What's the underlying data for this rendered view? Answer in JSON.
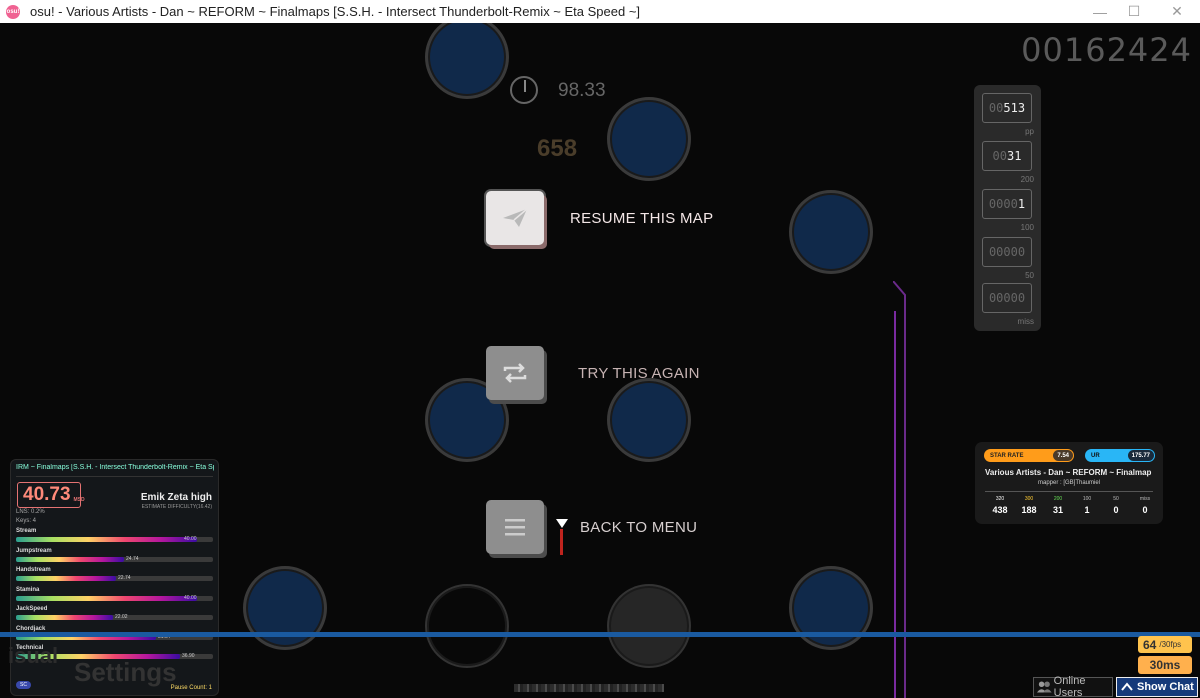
{
  "window": {
    "title": "osu!  - Various Artists - Dan ~ REFORM ~ Finalmaps [S.S.H. - Intersect Thunderbolt-Remix ~ Eta Speed ~]",
    "app_icon_text": "osu!",
    "minimize": "—",
    "maximize": "☐",
    "close": "✕"
  },
  "hud": {
    "score": "00162424",
    "accuracy": "98.33",
    "combo": "658"
  },
  "pause_menu": {
    "resume": "RESUME THIS MAP",
    "retry": "TRY THIS AGAIN",
    "back": "BACK TO MENU"
  },
  "judgement_counter": [
    {
      "lead": "00",
      "value": "513",
      "label": "pp"
    },
    {
      "lead": "00",
      "value": "31",
      "label": "200"
    },
    {
      "lead": "0000",
      "value": "1",
      "label": "100"
    },
    {
      "lead": "00000",
      "value": "",
      "label": "50"
    },
    {
      "lead": "00000",
      "value": "",
      "label": "miss"
    }
  ],
  "difficulty_panel": {
    "map_name": "IRM ~ Finalmaps [S.S.H. - Intersect Thunderbolt-Remix ~ Eta Speed",
    "msd_value": "40.73",
    "msd_unit": "MSD",
    "player_label": "Emik Zeta high",
    "estimate": "ESTIMATE DIFFICULTY(16.42)",
    "lns": "LNS: 0.2%",
    "keys": "Keys: 4",
    "skills": [
      {
        "name": "Stream",
        "value": "40.00",
        "fraction": 0.92
      },
      {
        "name": "Jumpstream",
        "value": "24.74",
        "fraction": 0.55
      },
      {
        "name": "Handstream",
        "value": "22.74",
        "fraction": 0.51
      },
      {
        "name": "Stamina",
        "value": "40.00",
        "fraction": 0.92
      },
      {
        "name": "JackSpeed",
        "value": "22.02",
        "fraction": 0.49
      },
      {
        "name": "Chordjack",
        "value": "31.54",
        "fraction": 0.71
      },
      {
        "name": "Technical",
        "value": "36.90",
        "fraction": 0.83
      }
    ],
    "sc_badge": "SC",
    "pause_count": "Pause Count: 1"
  },
  "ghost_text": {
    "visual": "isual",
    "settings": "Settings"
  },
  "map_info": {
    "star_rate_label": "STAR RATE",
    "star_rate_value": "7.54",
    "ur_label": "UR",
    "ur_value": "175.77",
    "song": "Various Artists - Dan ~ REFORM ~ Finalmap",
    "mapper": "mapper : [GB]Thaumiel",
    "hits": [
      {
        "label": "320",
        "count": "438",
        "color": "#ffffff"
      },
      {
        "label": "300",
        "count": "188",
        "color": "#ffcc33"
      },
      {
        "label": "200",
        "count": "31",
        "color": "#66dd55"
      },
      {
        "label": "100",
        "count": "1",
        "color": "#bbbbbb"
      },
      {
        "label": "50",
        "count": "0",
        "color": "#bbbbbb"
      },
      {
        "label": "miss",
        "count": "0",
        "color": "#bbbbbb"
      }
    ]
  },
  "perf": {
    "fps": "64",
    "fps_cap": "/30fps",
    "latency": "30ms"
  },
  "footer": {
    "online_users": "Online Users",
    "show_chat": "Show Chat"
  },
  "colors": {
    "note_fill": "#10294a",
    "star_pill": "#ff9c1a",
    "ur_pill": "#29b6f6",
    "fps_badge": "#ffc34d"
  }
}
